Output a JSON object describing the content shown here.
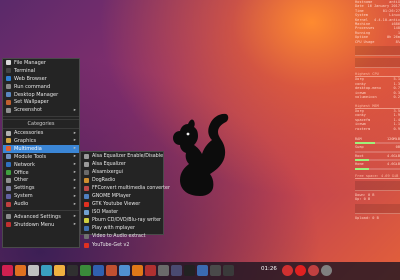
{
  "conky": {
    "sys_rows": [
      [
        "Hostname",
        "antiX"
      ],
      [
        "Date",
        "16 January 2017"
      ],
      [
        "Time",
        "01:26:27"
      ],
      [
        "System",
        "Linux"
      ],
      [
        "Kernel",
        "4.4.10-antix"
      ],
      [
        "Machine",
        "i686"
      ],
      [
        "Processes",
        "148"
      ],
      [
        "Running",
        "1"
      ],
      [
        "Uptime",
        "0h 26m"
      ],
      [
        "CPU Usage",
        "8%"
      ]
    ],
    "cpu_title": "Highest CPU",
    "cpu_procs": [
      [
        "Xorg",
        "5.1"
      ],
      [
        "conky",
        "1.3"
      ],
      [
        "desktop-menu",
        "0.7"
      ],
      [
        "icewm",
        "0.3"
      ],
      [
        "volumeicon",
        "0.2"
      ]
    ],
    "mem_title": "Highest MEM",
    "mem_procs": [
      [
        "Xorg",
        "3.5"
      ],
      [
        "conky",
        "1.9"
      ],
      [
        "spacefm",
        "1.4"
      ],
      [
        "icewm",
        "1.1"
      ],
      [
        "roxterm",
        "0.9"
      ]
    ],
    "fs_rows": [
      [
        "RAM",
        "120MiB"
      ],
      [
        "Swap",
        "0B"
      ],
      [
        "Root",
        "4.6GiB"
      ],
      [
        "Home",
        "4.6GiB"
      ]
    ],
    "disk_label": "Free space: 4.69 GiB",
    "down_label": "Down: 0 B",
    "up_label": "Up: 0 B",
    "bottom_label": "Upload: 0 B"
  },
  "menu": {
    "items": [
      {
        "label": "File Manager",
        "color": "#d8d8d8"
      },
      {
        "label": "Terminal",
        "color": "#444444"
      },
      {
        "label": "Web Browser",
        "color": "#2f7fd0"
      },
      {
        "label": "Run command",
        "color": "#888888"
      },
      {
        "label": "Desktop Manager",
        "color": "#5a87c0"
      },
      {
        "label": "Set Wallpaper",
        "color": "#c06030"
      },
      {
        "label": "Screenshot",
        "color": "#909090",
        "arrow": true
      }
    ],
    "categories_header": "Categories",
    "categories": [
      {
        "label": "Accessories",
        "color": "#b0b0b0"
      },
      {
        "label": "Graphics",
        "color": "#d0a040"
      },
      {
        "label": "Multimedia",
        "color": "#e06030",
        "selected": true
      },
      {
        "label": "Module Tools",
        "color": "#7090c0"
      },
      {
        "label": "Network",
        "color": "#3070c0"
      },
      {
        "label": "Office",
        "color": "#40a040"
      },
      {
        "label": "Other",
        "color": "#909090"
      },
      {
        "label": "Settings",
        "color": "#8080a0"
      },
      {
        "label": "System",
        "color": "#6060a0"
      },
      {
        "label": "Audio",
        "color": "#c04040"
      }
    ],
    "advanced_settings": "Advanced Settings",
    "shutdown": "Shutdown Menu",
    "arrow_glyph": "▸"
  },
  "submenu": {
    "items": [
      {
        "label": "Alsa Equalizer Enable/Disable",
        "color": "#9a9a9a"
      },
      {
        "label": "Alsa Equalizer",
        "color": "#9a9a9a"
      },
      {
        "label": "Alsamixergui",
        "color": "#6a6a6a"
      },
      {
        "label": "DogRadio",
        "color": "#d09030"
      },
      {
        "label": "FFConvert multimedia converter",
        "color": "#c04848"
      },
      {
        "label": "GNOME MPlayer",
        "color": "#5080c0"
      },
      {
        "label": "GTK Youtube Viewer",
        "color": "#e03020"
      },
      {
        "label": "ISO Master",
        "color": "#70a0d0"
      },
      {
        "label": "Pburn CD/DVD/Blu-ray writer",
        "color": "#d0d040"
      },
      {
        "label": "Play with mplayer",
        "color": "#4070b0"
      },
      {
        "label": "Video to Audio extract",
        "color": "#707070"
      },
      {
        "label": "YouTube-Get v2",
        "color": "#e03020"
      }
    ]
  },
  "taskbar": {
    "icons": [
      {
        "name": "debian-swirl-icon",
        "color": "#d02050"
      },
      {
        "name": "firefox-icon",
        "color": "#e07020"
      },
      {
        "name": "cat-icon",
        "color": "#bfbfbf"
      },
      {
        "name": "picture-icon",
        "color": "#3aa0c0"
      },
      {
        "name": "folder-icon",
        "color": "#f0b040"
      },
      {
        "name": "film-icon",
        "color": "#303030"
      },
      {
        "name": "spreadsheet-icon",
        "color": "#3a8a3a"
      },
      {
        "name": "document-icon",
        "color": "#3060b0"
      },
      {
        "name": "presentation-icon",
        "color": "#c05030"
      },
      {
        "name": "gallery-icon",
        "color": "#5090d0"
      },
      {
        "name": "media-player-icon",
        "color": "#e07818"
      },
      {
        "name": "games-icon",
        "color": "#b03030"
      },
      {
        "name": "tools-icon",
        "color": "#6a6a6a"
      },
      {
        "name": "mail-icon",
        "color": "#4a4a70"
      },
      {
        "name": "terminal-icon",
        "color": "#222222"
      },
      {
        "name": "accessibility-icon",
        "color": "#3a6ab0"
      },
      {
        "name": "network-icon",
        "color": "#4a4a4a"
      },
      {
        "name": "volume-icon",
        "color": "#3a3a3a"
      }
    ],
    "clock": "01:26",
    "tray": [
      {
        "name": "shield-icon",
        "color": "#d03030"
      },
      {
        "name": "record-icon",
        "color": "#e02020"
      },
      {
        "name": "power-icon",
        "color": "#c04040"
      },
      {
        "name": "lock-icon",
        "color": "#808080"
      }
    ]
  }
}
